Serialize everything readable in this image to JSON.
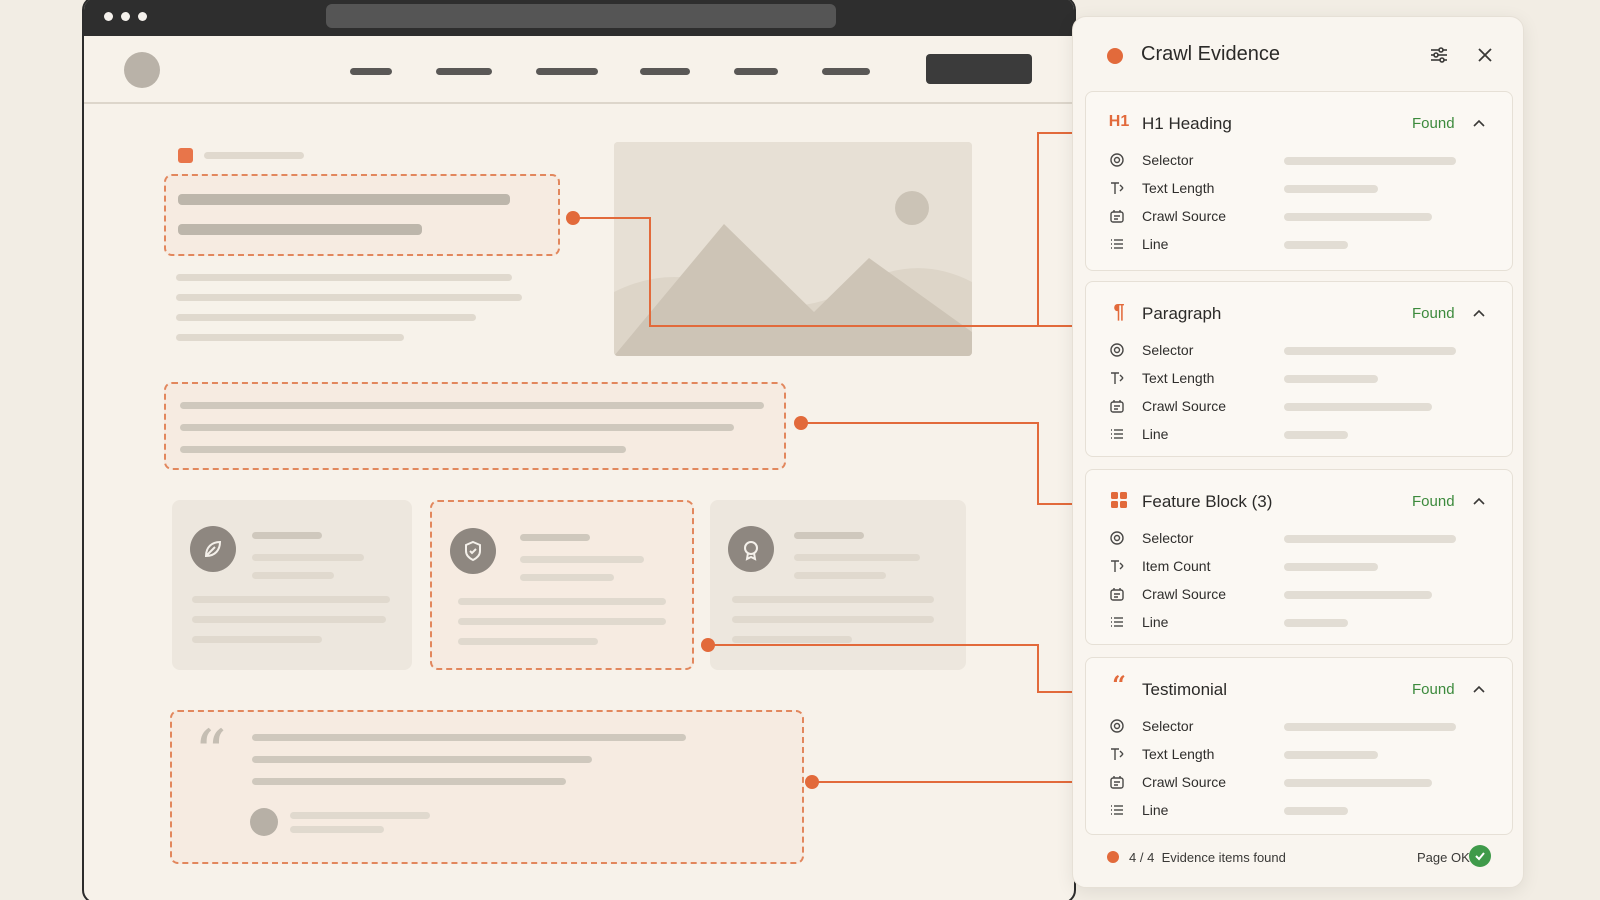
{
  "panel": {
    "title": "Crawl Evidence",
    "filter_icon": "sliders-icon",
    "close_icon": "close-icon",
    "sections": [
      {
        "icon": "h1-icon",
        "icon_text": "H1",
        "title": "H1 Heading",
        "status": "Found",
        "rows": [
          {
            "icon": "target-icon",
            "label": "Selector"
          },
          {
            "icon": "text-length-icon",
            "label": "Text Length"
          },
          {
            "icon": "crawl-source-icon",
            "label": "Crawl Source"
          },
          {
            "icon": "list-icon",
            "label": "Line"
          }
        ]
      },
      {
        "icon": "pilcrow-icon",
        "icon_text": "¶",
        "title": "Paragraph",
        "status": "Found",
        "rows": [
          {
            "icon": "target-icon",
            "label": "Selector"
          },
          {
            "icon": "text-length-icon",
            "label": "Text Length"
          },
          {
            "icon": "crawl-source-icon",
            "label": "Crawl Source"
          },
          {
            "icon": "list-icon",
            "label": "Line"
          }
        ]
      },
      {
        "icon": "grid-icon",
        "icon_text": "",
        "title": "Feature Block (3)",
        "status": "Found",
        "rows": [
          {
            "icon": "target-icon",
            "label": "Selector"
          },
          {
            "icon": "text-length-icon",
            "label": "Item Count"
          },
          {
            "icon": "crawl-source-icon",
            "label": "Crawl Source"
          },
          {
            "icon": "list-icon",
            "label": "Line"
          }
        ]
      },
      {
        "icon": "quote-icon",
        "icon_text": "66",
        "title": "Testimonial",
        "status": "Found",
        "rows": [
          {
            "icon": "target-icon",
            "label": "Selector"
          },
          {
            "icon": "text-length-icon",
            "label": "Text Length"
          },
          {
            "icon": "crawl-source-icon",
            "label": "Crawl Source"
          },
          {
            "icon": "list-icon",
            "label": "Line"
          }
        ]
      }
    ],
    "footer": {
      "found": "4",
      "sep": "/",
      "total": "4",
      "label": "Evidence items found",
      "page_status": "Page OK"
    }
  },
  "colors": {
    "accent": "#e26a3b",
    "found": "#3c8a3c",
    "ok": "#3f9a4a",
    "page_bg": "#f2ede4"
  }
}
